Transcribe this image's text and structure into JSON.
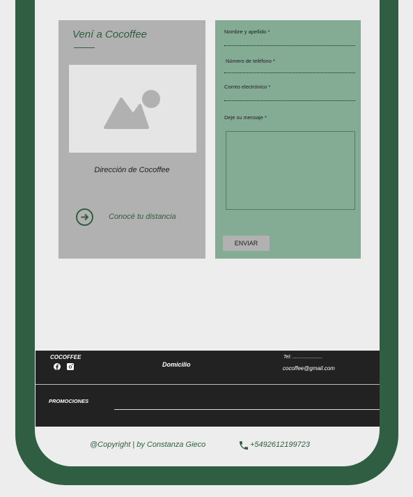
{
  "colors": {
    "frame": "#2f5e42",
    "page": "#ededed",
    "left_card": "#b1b1b1",
    "form_card": "#84ab94",
    "footer": "#222222"
  },
  "location": {
    "title": "Vení a Cocoffee",
    "image_icon": "image-placeholder-icon",
    "address": "Dirección de Cocoffee",
    "distance_link": "Conocé tu distancia",
    "arrow_icon": "arrow-right-circle-icon"
  },
  "form": {
    "fields": {
      "name": "Nombre y apellido *",
      "phone": "Número de teléfono *",
      "email": "Correo electrónico *",
      "message": "Deje su mensaje *"
    },
    "submit": "ENVIAR"
  },
  "footer": {
    "brand": "COCOFFEE",
    "social_icons": [
      "facebook-icon",
      "instagram-icon"
    ],
    "domicilio": "Domicilio",
    "tel": "Tel: ......................",
    "email": "cocoffee@gmail.com",
    "promociones": "PROMOCIONES"
  },
  "bottom": {
    "copyright": "@Copyright | by Constanza Gieco",
    "phone_icon": "phone-icon",
    "phone": "+5492612199723"
  }
}
